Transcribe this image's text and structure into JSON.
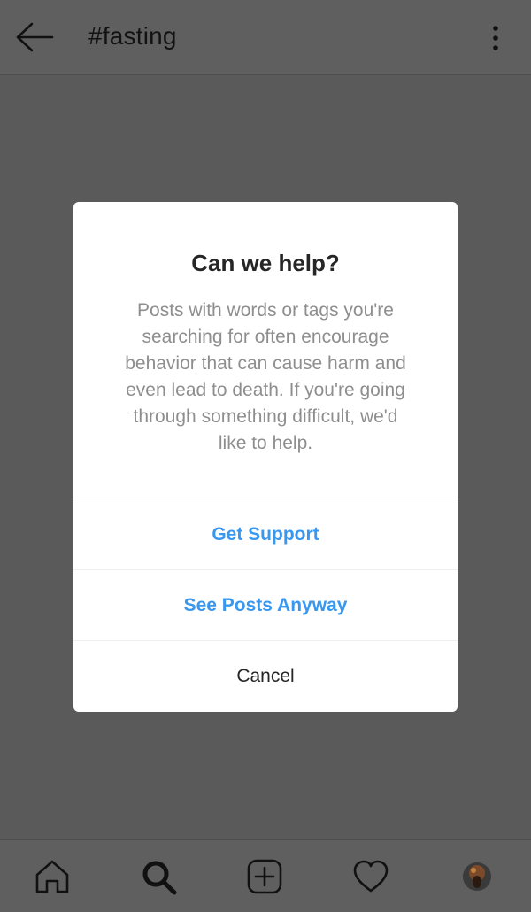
{
  "header": {
    "title": "#fasting",
    "back_icon": "arrow-left-icon",
    "more_icon": "more-vertical-icon"
  },
  "dialog": {
    "title": "Can we help?",
    "body_lines": [
      "Posts with words or tags you're",
      "searching for often encourage",
      "behavior that can cause harm and",
      "even lead to death. If you're going",
      "through something difficult, we'd",
      "like to help."
    ],
    "buttons": {
      "get_support": "Get Support",
      "see_posts_anyway": "See Posts Anyway",
      "cancel": "Cancel"
    }
  },
  "bottom_nav": {
    "items": [
      "home-icon",
      "search-icon",
      "add-post-icon",
      "activity-heart-icon",
      "profile-avatar"
    ]
  },
  "colors": {
    "overlay_background": "#5a5a5a",
    "dialog_background": "#ffffff",
    "action_blue": "#3897f0",
    "body_text": "#8e8e8e",
    "title_text": "#262626"
  }
}
